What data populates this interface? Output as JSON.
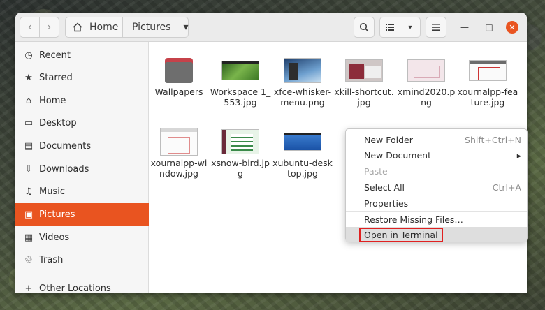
{
  "header": {
    "back_icon": "‹",
    "forward_icon": "›",
    "breadcrumb_home": "Home",
    "breadcrumb_current": "Pictures",
    "dropdown_icon": "▾",
    "search_icon": "⌕",
    "view_icon": "☰",
    "view_dropdown_icon": "▾",
    "menu_icon": "≡",
    "minimize_icon": "—",
    "maximize_icon": "□",
    "close_icon": "✕",
    "accent_color": "#e95420"
  },
  "sidebar": {
    "items": [
      {
        "label": "Recent",
        "icon": "◷"
      },
      {
        "label": "Starred",
        "icon": "★"
      },
      {
        "label": "Home",
        "icon": "⌂"
      },
      {
        "label": "Desktop",
        "icon": "▭"
      },
      {
        "label": "Documents",
        "icon": "▤"
      },
      {
        "label": "Downloads",
        "icon": "⇩"
      },
      {
        "label": "Music",
        "icon": "♫"
      },
      {
        "label": "Pictures",
        "icon": "▣"
      },
      {
        "label": "Videos",
        "icon": "▦"
      },
      {
        "label": "Trash",
        "icon": "♲"
      },
      {
        "label": "Other Locations",
        "icon": "+"
      }
    ]
  },
  "files": [
    {
      "name": "Wallpapers"
    },
    {
      "name": "Workspace 1_553.jpg"
    },
    {
      "name": "xfce-whisker-menu.png"
    },
    {
      "name": "xkill-shortcut.jpg"
    },
    {
      "name": "xmind2020.png"
    },
    {
      "name": "xournalpp-feature.jpg"
    },
    {
      "name": "xournalpp-window.jpg"
    },
    {
      "name": "xsnow-bird.jpg"
    },
    {
      "name": "xubuntu-desktop.jpg"
    }
  ],
  "context_menu": {
    "new_folder": {
      "label": "New Folder",
      "accel": "Shift+Ctrl+N"
    },
    "new_document": {
      "label": "New Document",
      "accel": "▸"
    },
    "paste": {
      "label": "Paste"
    },
    "select_all": {
      "label": "Select All",
      "accel": "Ctrl+A"
    },
    "properties": {
      "label": "Properties"
    },
    "restore": {
      "label": "Restore Missing Files…"
    },
    "open_terminal": {
      "label": "Open in Terminal"
    }
  }
}
